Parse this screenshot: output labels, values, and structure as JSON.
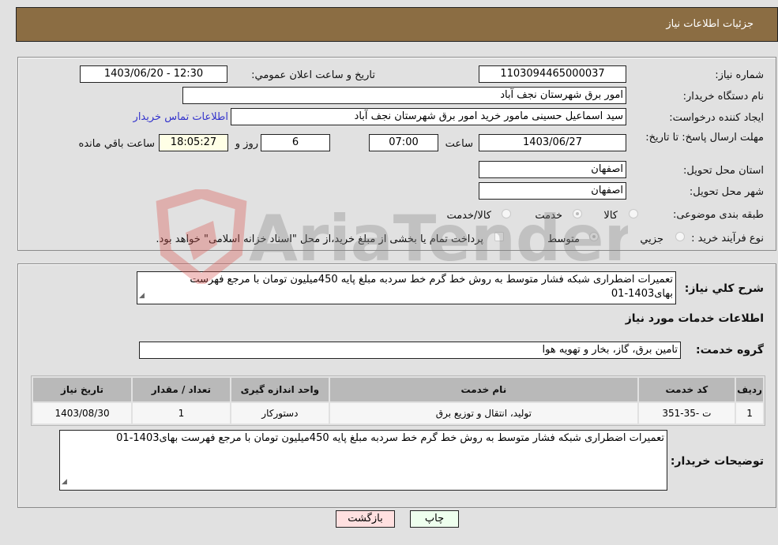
{
  "header": {
    "title": "جزئیات اطلاعات نیاز"
  },
  "info": {
    "need_number_label": "شماره نیاز:",
    "need_number": "1103094465000037",
    "announce_label": "تاريخ و ساعت اعلان عمومي:",
    "announce_value": "1403/06/20 - 12:30",
    "buyer_org_label": "نام دستگاه خريدار:",
    "buyer_org": "امور برق شهرستان نجف آباد",
    "creator_label": "ايجاد کننده درخواست:",
    "creator": "سید اسماعیل  حسینی  مامور خرید  امور برق شهرستان نجف آباد",
    "contact_link": "اطلاعات تماس خريدار",
    "deadline_label": "مهلت ارسال پاسخ: تا تاریخ:",
    "deadline_date": "1403/06/27",
    "time_label": "ساعت",
    "deadline_time": "07:00",
    "days_value": "6",
    "days_label": "روز و",
    "remaining_time": "18:05:27",
    "remaining_label": "ساعت باقي مانده",
    "province_label": "استان محل تحويل:",
    "province": "اصفهان",
    "city_label": "شهر محل تحويل:",
    "city": "اصفهان",
    "category_label": "طبقه بندی موضوعی:",
    "category_options": [
      {
        "label": "کالا",
        "selected": false
      },
      {
        "label": "خدمت",
        "selected": true
      },
      {
        "label": "کالا/خدمت",
        "selected": false
      }
    ],
    "purchase_type_label": "نوع فرآيند خريد :",
    "purchase_type_options": [
      {
        "label": "جزيي",
        "selected": false
      },
      {
        "label": "متوسط",
        "selected": true
      }
    ],
    "treasury_note": "پرداخت تمام يا بخشی از مبلغ خريد،از محل \"اسناد خزانه اسلامی\" خواهد بود.",
    "treasury_checked": false
  },
  "description": {
    "label": "شرح کلي نياز:",
    "text": "تعمیرات اضطراری  شبکه فشار متوسط به روش خط گرم خط سردبه مبلغ پایه 450میلیون تومان با مرجع فهرست بهای1403-01",
    "services_title": "اطلاعات خدمات مورد نياز",
    "service_group_label": "گروه خدمت:",
    "service_group": "تامين برق، گاز، بخار و تهويه هوا"
  },
  "table": {
    "headers": [
      "رديف",
      "کد خدمت",
      "نام خدمت",
      "واحد اندازه گيری",
      "تعداد / مقدار",
      "تاريخ نياز"
    ],
    "rows": [
      [
        "1",
        "ت -35-351",
        "توليد، انتقال و توزيع برق",
        "دستورکار",
        "1",
        "1403/08/30"
      ]
    ]
  },
  "buyer_notes": {
    "label": "توضيحات خريدار:",
    "text": "تعمیرات اضطراری  شبکه فشار متوسط به روش خط گرم خط سردبه مبلغ پایه 450میلیون تومان با مرجع فهرست بهای1403-01"
  },
  "buttons": {
    "print": "چاپ",
    "back": "بازگشت"
  },
  "watermark": {
    "text": "AriaTender.neT"
  }
}
